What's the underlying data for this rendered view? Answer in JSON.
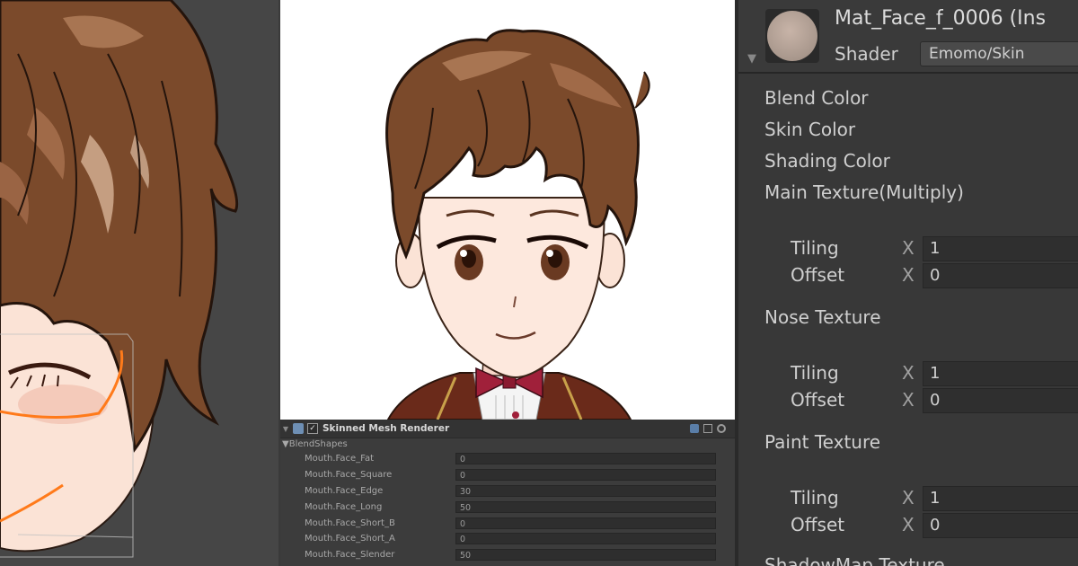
{
  "component": {
    "title": "Skinned Mesh Renderer",
    "group_label": "BlendShapes",
    "blend_shapes": [
      {
        "label": "Mouth.Face_Fat",
        "value": "0"
      },
      {
        "label": "Mouth.Face_Square",
        "value": "0"
      },
      {
        "label": "Mouth.Face_Edge",
        "value": "30"
      },
      {
        "label": "Mouth.Face_Long",
        "value": "50"
      },
      {
        "label": "Mouth.Face_Short_B",
        "value": "0"
      },
      {
        "label": "Mouth.Face_Short_A",
        "value": "0"
      },
      {
        "label": "Mouth.Face_Slender",
        "value": "50"
      }
    ]
  },
  "material": {
    "name": "Mat_Face_f_0006 (Ins",
    "shader_label": "Shader",
    "shader_value": "Emomo/Skin",
    "properties": {
      "blend_color": "Blend Color",
      "skin_color": "Skin Color",
      "shading_color": "Shading Color",
      "main_texture": "Main Texture(Multiply)",
      "nose_texture": "Nose Texture",
      "paint_texture": "Paint Texture",
      "shadowmap_texture": "ShadowMap Texture"
    },
    "texture_blocks": [
      {
        "tiling_label": "Tiling",
        "tiling_axis": "X",
        "tiling_x": "1",
        "offset_label": "Offset",
        "offset_axis": "X",
        "offset_x": "0"
      },
      {
        "tiling_label": "Tiling",
        "tiling_axis": "X",
        "tiling_x": "1",
        "offset_label": "Offset",
        "offset_axis": "X",
        "offset_x": "0"
      },
      {
        "tiling_label": "Tiling",
        "tiling_axis": "X",
        "tiling_x": "1",
        "offset_label": "Offset",
        "offset_axis": "X",
        "offset_x": "0"
      }
    ]
  },
  "colors": {
    "editor_bg": "#383838",
    "hair": "#7a4a2a",
    "skin": "#fce6da",
    "selection_outline": "#ff7a1a",
    "blazer": "#6a2a1a",
    "bowtie": "#a0203a"
  },
  "icons": {
    "component_icon": "skinned-mesh-icon",
    "enabled_checkbox": "checkmark-icon",
    "help": "help-icon",
    "presets": "presets-icon",
    "settings": "gear-icon"
  }
}
